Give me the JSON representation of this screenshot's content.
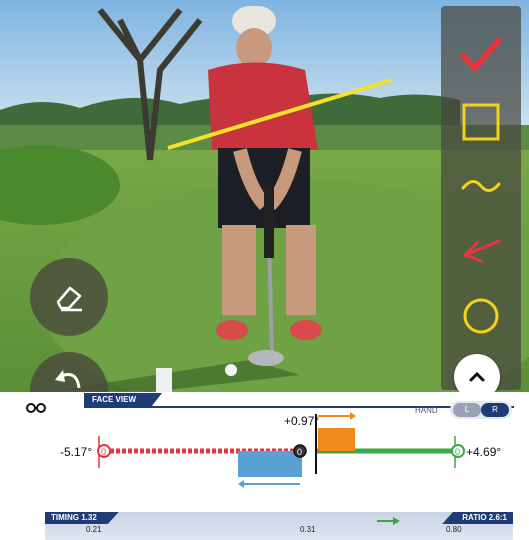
{
  "toolbar": {
    "tools": [
      {
        "name": "check-tool",
        "icon": "checkmark-icon",
        "color": "#e53640"
      },
      {
        "name": "rectangle-tool",
        "icon": "square-icon",
        "color": "#f2d21b"
      },
      {
        "name": "curve-tool",
        "icon": "wave-icon",
        "color": "#f2d21b"
      },
      {
        "name": "arrow-tool",
        "icon": "arrow-icon",
        "color": "#e53640"
      },
      {
        "name": "circle-tool",
        "icon": "circle-icon",
        "color": "#f2d21b"
      }
    ]
  },
  "face_view": {
    "tab_label": "FACE VIEW",
    "hand_label": "HAND",
    "hand_left": "L",
    "hand_right": "R",
    "selected_hand": "R",
    "left_value": "-5.17°",
    "right_value": "+4.69°",
    "impact_value": "+0.97°",
    "address_marker": "0",
    "start_marker": "0",
    "end_marker": "0"
  },
  "timing": {
    "timing_label": "TIMING 1.32",
    "ratio_label": "RATIO 2.6:1",
    "backswing": "0.21",
    "downswing": "0.31",
    "follow": "0.80"
  },
  "colors": {
    "accent": "#1f3c78",
    "red": "#e53640",
    "green": "#3aa845",
    "blue_bar": "#5aa0d2",
    "orange_bar": "#f08a1a",
    "yellow": "#f2d21b"
  }
}
